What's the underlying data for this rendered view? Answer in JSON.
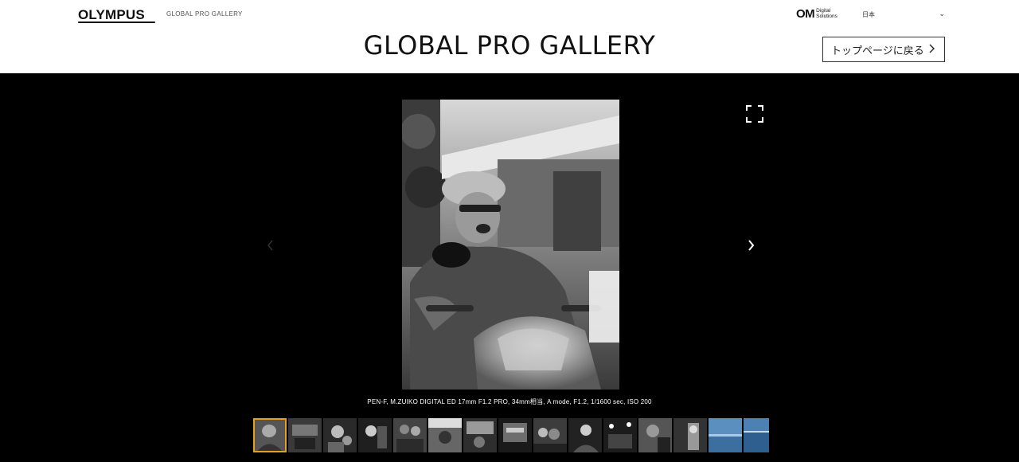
{
  "header": {
    "brand": "OLYMPUS",
    "site_subtitle": "GLOBAL PRO GALLERY",
    "partner_logo_main": "OM",
    "partner_logo_line1": "Digital",
    "partner_logo_line2": "Solutions",
    "language_value": "日本",
    "language_icon": "chevron-down-icon"
  },
  "page": {
    "title": "GLOBAL PRO GALLERY",
    "back_button_label": "トップページに戻る",
    "back_button_icon": "chevron-right-icon"
  },
  "viewer": {
    "caption": "PEN-F, M.ZUIKO DIGITAL ED 17mm F1.2 PRO, 34mm相当, A mode, F1.2, 1/1600 sec, ISO 200",
    "expand_icon": "fullscreen-icon",
    "prev_icon": "chevron-left-icon",
    "next_icon": "chevron-right-icon",
    "active_thumb_color": "#e6a020",
    "thumbnail_count": 15,
    "active_thumbnail": 1
  }
}
